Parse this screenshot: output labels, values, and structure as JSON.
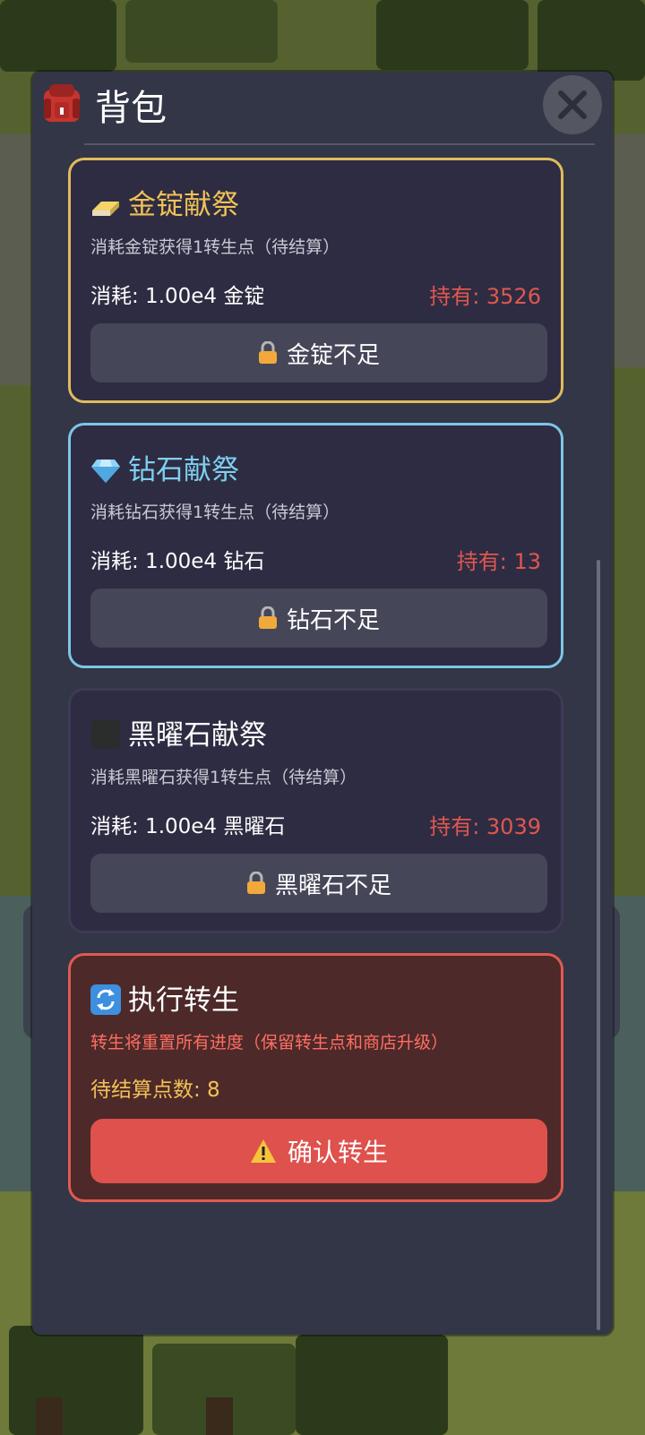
{
  "panel": {
    "title": "背包",
    "close_icon": "close-icon",
    "bag_icon": "backpack-icon"
  },
  "cards": [
    {
      "id": "gold",
      "icon": "gold-bar-icon",
      "title": "金锭献祭",
      "desc": "消耗金锭获得1转生点（待结算）",
      "cost": "消耗: 1.00e4 金锭",
      "hold": "持有: 3526",
      "button": "金锭不足",
      "accent": "#e0bc5c"
    },
    {
      "id": "diamond",
      "icon": "diamond-icon",
      "title": "钻石献祭",
      "desc": "消耗钻石获得1转生点（待结算）",
      "cost": "消耗: 1.00e4 钻石",
      "hold": "持有: 13",
      "button": "钻石不足",
      "accent": "#7cc6e8"
    },
    {
      "id": "obsidian",
      "icon": "obsidian-block-icon",
      "title": "黑曜石献祭",
      "desc": "消耗黑曜石获得1转生点（待结算）",
      "cost": "消耗: 1.00e4 黑曜石",
      "hold": "持有: 3039",
      "button": "黑曜石不足",
      "accent": "#3e3a56"
    }
  ],
  "rebirth": {
    "icon": "refresh-icon",
    "title": "执行转生",
    "warning": "转生将重置所有进度（保留转生点和商店升级）",
    "pending": "待结算点数: 8",
    "button": "确认转生",
    "button_icon": "warning-icon",
    "accent": "#e05a52"
  }
}
